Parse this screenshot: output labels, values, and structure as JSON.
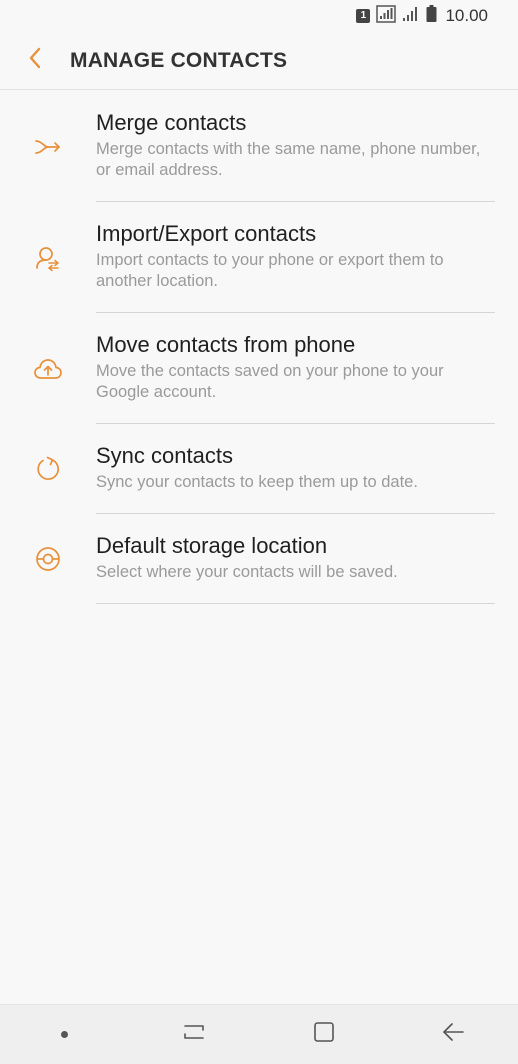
{
  "status_bar": {
    "sim_label": "1",
    "time": "10.00"
  },
  "header": {
    "title": "MANAGE CONTACTS",
    "back_icon": "chevron-left-icon"
  },
  "items": [
    {
      "title": "Merge contacts",
      "subtitle": "Merge contacts with the same name, phone number, or email address.",
      "icon": "merge-icon"
    },
    {
      "title": "Import/Export contacts",
      "subtitle": "Import contacts to your phone or export them to another location.",
      "icon": "import-export-icon"
    },
    {
      "title": "Move contacts from phone",
      "subtitle": "Move the contacts saved on your phone to your Google account.",
      "icon": "cloud-upload-icon"
    },
    {
      "title": "Sync contacts",
      "subtitle": "Sync your contacts to keep them up to date.",
      "icon": "sync-icon"
    },
    {
      "title": "Default storage location",
      "subtitle": "Select where your contacts will be saved.",
      "icon": "storage-icon"
    }
  ],
  "colors": {
    "accent": "#e8913a",
    "background": "#f8f8f8"
  }
}
